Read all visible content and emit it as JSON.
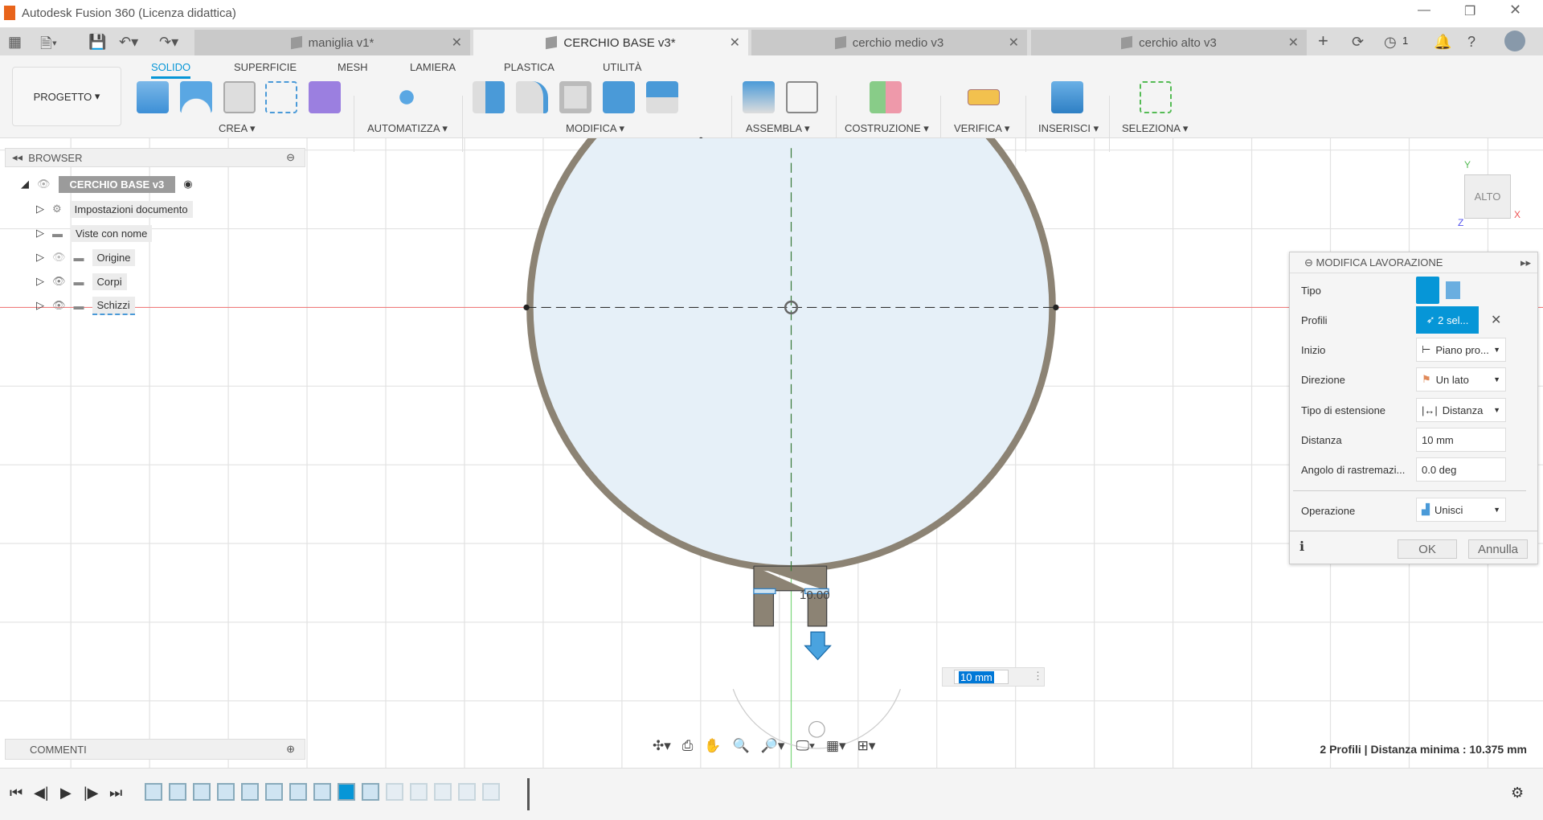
{
  "window": {
    "title": "Autodesk Fusion 360 (Licenza didattica)"
  },
  "tabs": [
    {
      "label": "maniglia v1*"
    },
    {
      "label": "CERCHIO BASE v3*"
    },
    {
      "label": "cerchio medio v3"
    },
    {
      "label": "cerchio alto v3"
    }
  ],
  "jobs_count": "1",
  "toolbar": {
    "project": "PROGETTO",
    "ribbon_tabs": [
      "SOLIDO",
      "SUPERFICIE",
      "MESH",
      "LAMIERA",
      "PLASTICA",
      "UTILITÀ"
    ],
    "groups": [
      "CREA",
      "AUTOMATIZZA",
      "MODIFICA",
      "ASSEMBLA",
      "COSTRUZIONE",
      "VERIFICA",
      "INSERISCI",
      "SELEZIONA"
    ]
  },
  "browser": {
    "title": "BROWSER",
    "root": "CERCHIO BASE v3",
    "items": [
      "Impostazioni documento",
      "Viste con nome",
      "Origine",
      "Corpi",
      "Schizzi"
    ]
  },
  "comments": {
    "title": "COMMENTI"
  },
  "viewcube": {
    "face": "ALTO",
    "x": "X",
    "y": "Y",
    "z": "Z"
  },
  "dimension": {
    "label": "10.00",
    "input": "10 mm"
  },
  "panel": {
    "title": "MODIFICA LAVORAZIONE",
    "rows": {
      "tipo": "Tipo",
      "profili": "Profili",
      "inizio": "Inizio",
      "direzione": "Direzione",
      "tipo_est": "Tipo di estensione",
      "distanza": "Distanza",
      "angolo": "Angolo di rastremazi...",
      "operazione": "Operazione"
    },
    "values": {
      "profili": "2 sel...",
      "inizio": "Piano pro...",
      "direzione": "Un lato",
      "tipo_est": "Distanza",
      "distanza": "10 mm",
      "angolo": "0.0 deg",
      "operazione": "Unisci"
    },
    "ok": "OK",
    "cancel": "Annulla"
  },
  "status": "2 Profili | Distanza minima : 10.375 mm",
  "colors": {
    "accent": "#0696d7",
    "body": "#8c8374",
    "fill": "#e6f0f8"
  }
}
